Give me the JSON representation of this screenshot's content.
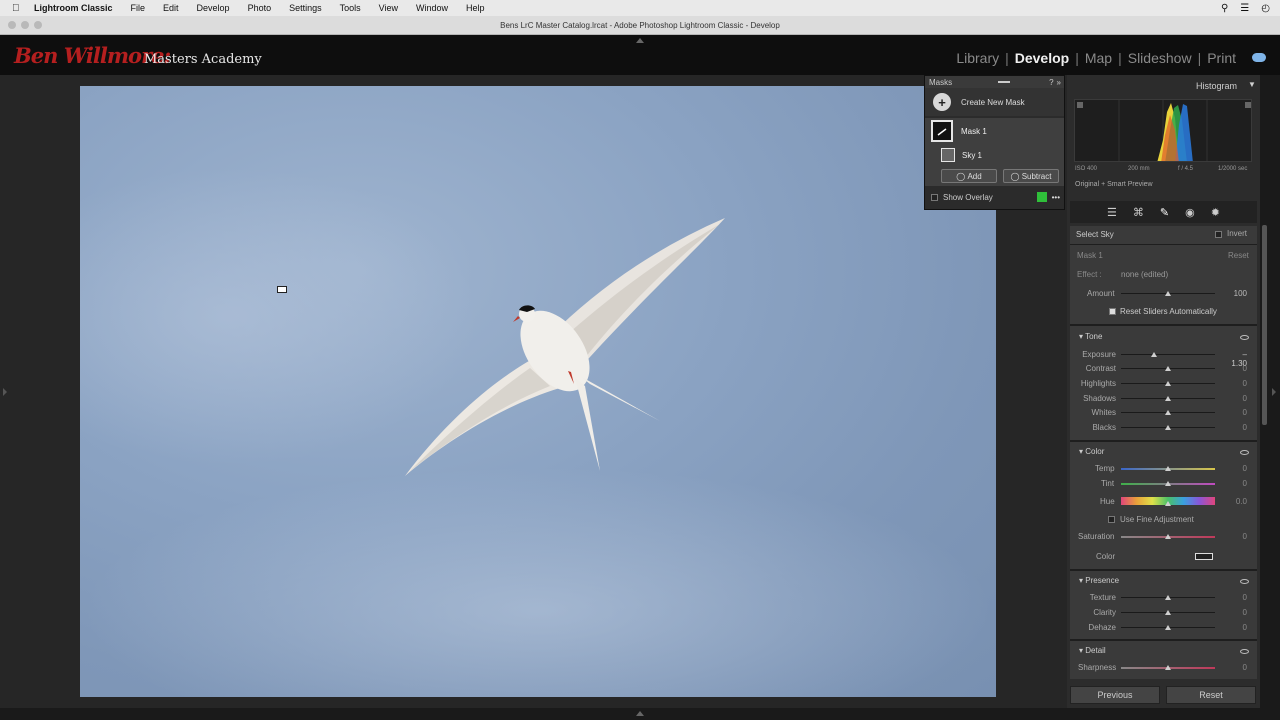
{
  "menubar": {
    "app": "Lightroom Classic",
    "items": [
      "File",
      "Edit",
      "Develop",
      "Photo",
      "Settings",
      "Tools",
      "View",
      "Window",
      "Help"
    ]
  },
  "window_title": "Bens LrC Master Catalog.lrcat - Adobe Photoshop Lightroom Classic - Develop",
  "brand": {
    "script": "Ben Willmore:",
    "name": "Masters Academy"
  },
  "modules": [
    "Library",
    "Develop",
    "Map",
    "Slideshow",
    "Print"
  ],
  "active_module": "Develop",
  "masks_panel": {
    "title": "Masks",
    "create_label": "Create New Mask",
    "mask_name": "Mask 1",
    "component_name": "Sky 1",
    "add_label": "Add",
    "subtract_label": "Subtract",
    "show_overlay_label": "Show Overlay",
    "overlay_color": "#2fbf3a"
  },
  "histogram": {
    "title": "Histogram",
    "iso": "ISO 400",
    "focal": "200 mm",
    "aperture": "f / 4.5",
    "shutter": "1/2000 sec",
    "preview": "Original + Smart Preview"
  },
  "mask_settings": {
    "select_label": "Select Sky",
    "invert_label": "Invert",
    "mask_label": "Mask 1",
    "reset_label": "Reset",
    "effect_label": "Effect :",
    "effect_value": "none (edited)",
    "amount_label": "Amount",
    "amount_value": "100",
    "reset_sliders_label": "Reset Sliders Automatically"
  },
  "tone": {
    "title": "Tone",
    "sliders": [
      {
        "label": "Exposure",
        "value": "– 1.30",
        "pos": 0.35
      },
      {
        "label": "Contrast",
        "value": "0",
        "pos": 0.5
      },
      {
        "label": "Highlights",
        "value": "0",
        "pos": 0.5
      },
      {
        "label": "Shadows",
        "value": "0",
        "pos": 0.5
      },
      {
        "label": "Whites",
        "value": "0",
        "pos": 0.5
      },
      {
        "label": "Blacks",
        "value": "0",
        "pos": 0.5
      }
    ]
  },
  "color": {
    "title": "Color",
    "temp_label": "Temp",
    "temp_value": "0",
    "tint_label": "Tint",
    "tint_value": "0",
    "hue_label": "Hue",
    "hue_value": "0.0",
    "fine_label": "Use Fine Adjustment",
    "saturation_label": "Saturation",
    "saturation_value": "0",
    "color_label": "Color"
  },
  "presence": {
    "title": "Presence",
    "sliders": [
      {
        "label": "Texture",
        "value": "0"
      },
      {
        "label": "Clarity",
        "value": "0"
      },
      {
        "label": "Dehaze",
        "value": "0"
      }
    ]
  },
  "detail": {
    "title": "Detail",
    "sharpness_label": "Sharpness",
    "sharpness_value": "0"
  },
  "footer": {
    "previous_label": "Previous",
    "reset_label": "Reset"
  }
}
